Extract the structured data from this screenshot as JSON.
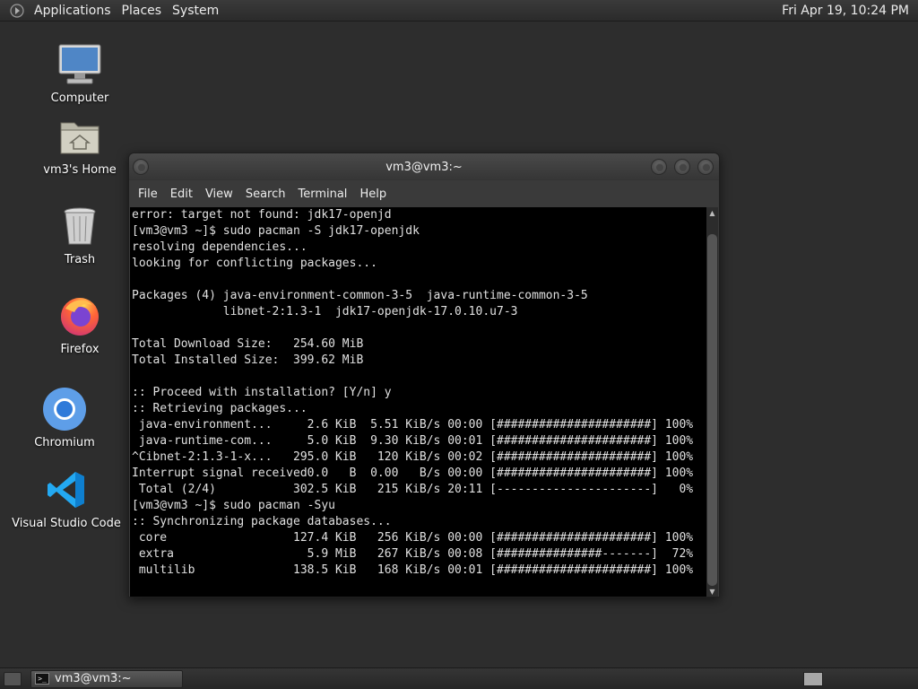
{
  "top_panel": {
    "menus": [
      "Applications",
      "Places",
      "System"
    ],
    "clock": "Fri Apr 19, 10:24 PM"
  },
  "desktop_icons": [
    {
      "label": "Computer",
      "icon": "computer-icon"
    },
    {
      "label": "vm3's Home",
      "icon": "home-folder-icon"
    },
    {
      "label": "Trash",
      "icon": "trash-icon"
    },
    {
      "label": "Firefox",
      "icon": "firefox-icon"
    },
    {
      "label": "Chromium",
      "icon": "chromium-icon"
    },
    {
      "label": "Visual Studio Code",
      "icon": "vscode-icon"
    }
  ],
  "terminal": {
    "title": "vm3@vm3:~",
    "menu": [
      "File",
      "Edit",
      "View",
      "Search",
      "Terminal",
      "Help"
    ],
    "lines": [
      "error: target not found: jdk17-openjd",
      "[vm3@vm3 ~]$ sudo pacman -S jdk17-openjdk",
      "resolving dependencies...",
      "looking for conflicting packages...",
      "",
      "Packages (4) java-environment-common-3-5  java-runtime-common-3-5",
      "             libnet-2:1.3-1  jdk17-openjdk-17.0.10.u7-3",
      "",
      "Total Download Size:   254.60 MiB",
      "Total Installed Size:  399.62 MiB",
      "",
      ":: Proceed with installation? [Y/n] y",
      ":: Retrieving packages...",
      " java-environment...     2.6 KiB  5.51 KiB/s 00:00 [######################] 100%",
      " java-runtime-com...     5.0 KiB  9.30 KiB/s 00:01 [######################] 100%",
      "^Cibnet-2:1.3-1-x...   295.0 KiB   120 KiB/s 00:02 [######################] 100%",
      "Interrupt signal received0.0   B  0.00   B/s 00:00 [######################] 100%",
      " Total (2/4)           302.5 KiB   215 KiB/s 20:11 [----------------------]   0%",
      "[vm3@vm3 ~]$ sudo pacman -Syu",
      ":: Synchronizing package databases...",
      " core                  127.4 KiB   256 KiB/s 00:00 [######################] 100%",
      " extra                   5.9 MiB   267 KiB/s 00:08 [###############-------]  72%",
      " multilib              138.5 KiB   168 KiB/s 00:01 [######################] 100%"
    ]
  },
  "taskbar": {
    "task_label": "vm3@vm3:~"
  },
  "colors": {
    "panel": "#2b2b2b",
    "desktop": "#2d2d2d",
    "terminal_bg": "#000000",
    "terminal_fg": "#e0e0e0"
  }
}
